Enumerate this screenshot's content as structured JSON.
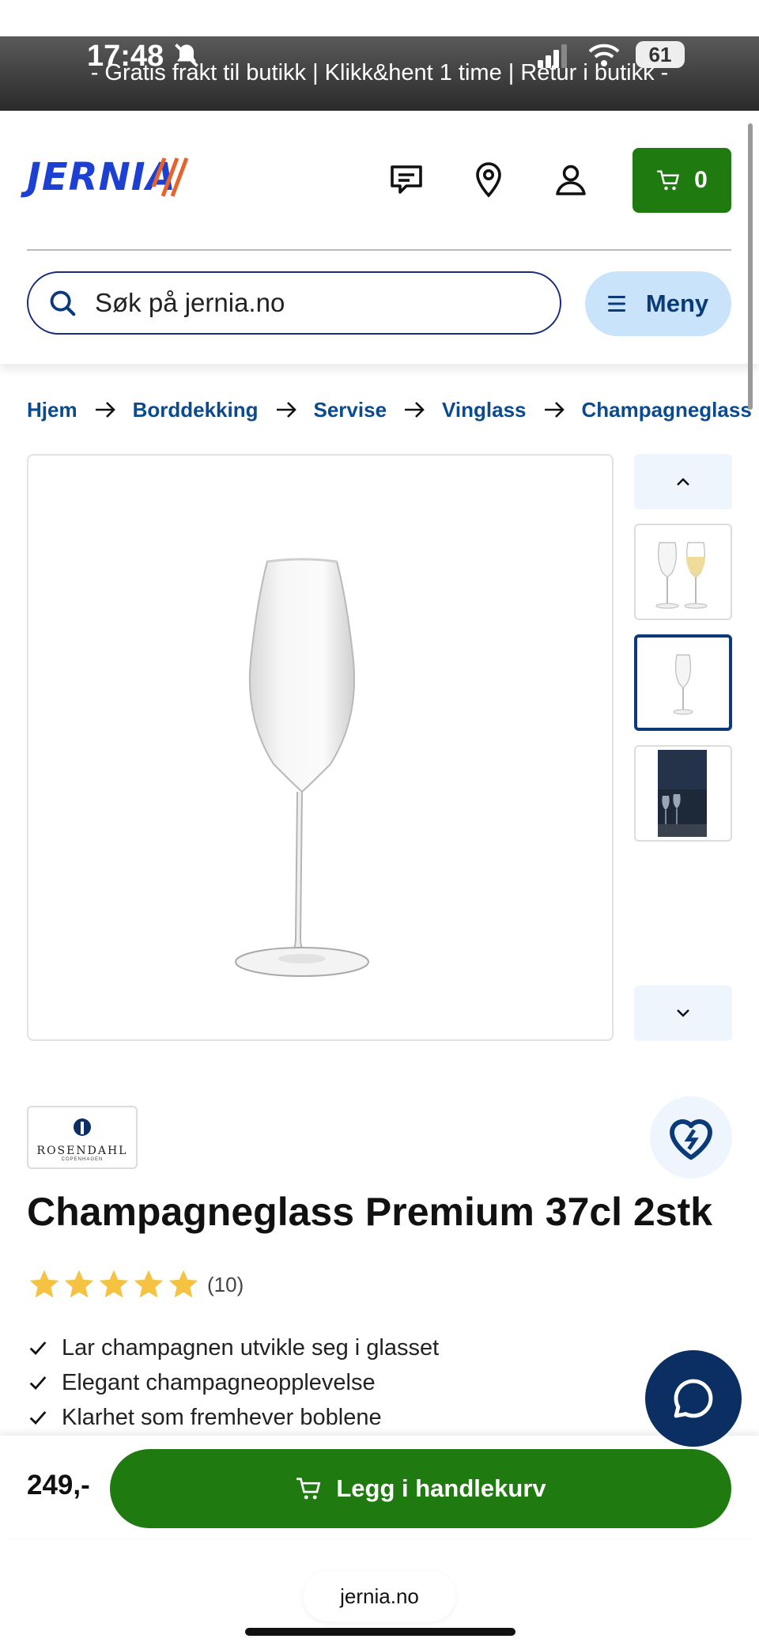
{
  "status": {
    "time": "17:48",
    "battery": "61"
  },
  "promo": {
    "text": "- Gratis frakt til butikk | Klikk&hent 1 time | Retur i butikk -"
  },
  "header": {
    "logo_text": "JERNIA",
    "cart_count": "0",
    "search_placeholder": "Søk på jernia.no",
    "menu_label": "Meny"
  },
  "breadcrumb": [
    "Hjem",
    "Borddekking",
    "Servise",
    "Vinglass",
    "Champagneglass"
  ],
  "product": {
    "brand_name": "ROSENDAHL",
    "brand_sub": "COPENHAGEN",
    "title": "Champagneglass Premium 37cl 2stk",
    "rating": 5,
    "review_count": "(10)",
    "features": [
      "Lar champagnen utvikle seg i glasset",
      "Elegant champagneopplevelse",
      "Klarhet som fremhever boblene"
    ],
    "price": "249,-",
    "add_to_cart_label": "Legg i handlekurv"
  },
  "browser": {
    "url": "jernia.no"
  },
  "colors": {
    "brand_blue": "#1c3fd4",
    "navy": "#0b3a78",
    "green": "#1f7a10",
    "accent_orange": "#e8632b",
    "star": "#f5c242"
  },
  "icons": [
    "bell-slash-icon",
    "signal-icon",
    "wifi-icon",
    "chat-icon",
    "location-pin-icon",
    "user-icon",
    "cart-icon",
    "search-icon",
    "menu-icon",
    "arrow-right-icon",
    "chevron-up-icon",
    "chevron-down-icon",
    "heart-icon",
    "star-icon",
    "check-icon",
    "chat-bubble-icon"
  ]
}
